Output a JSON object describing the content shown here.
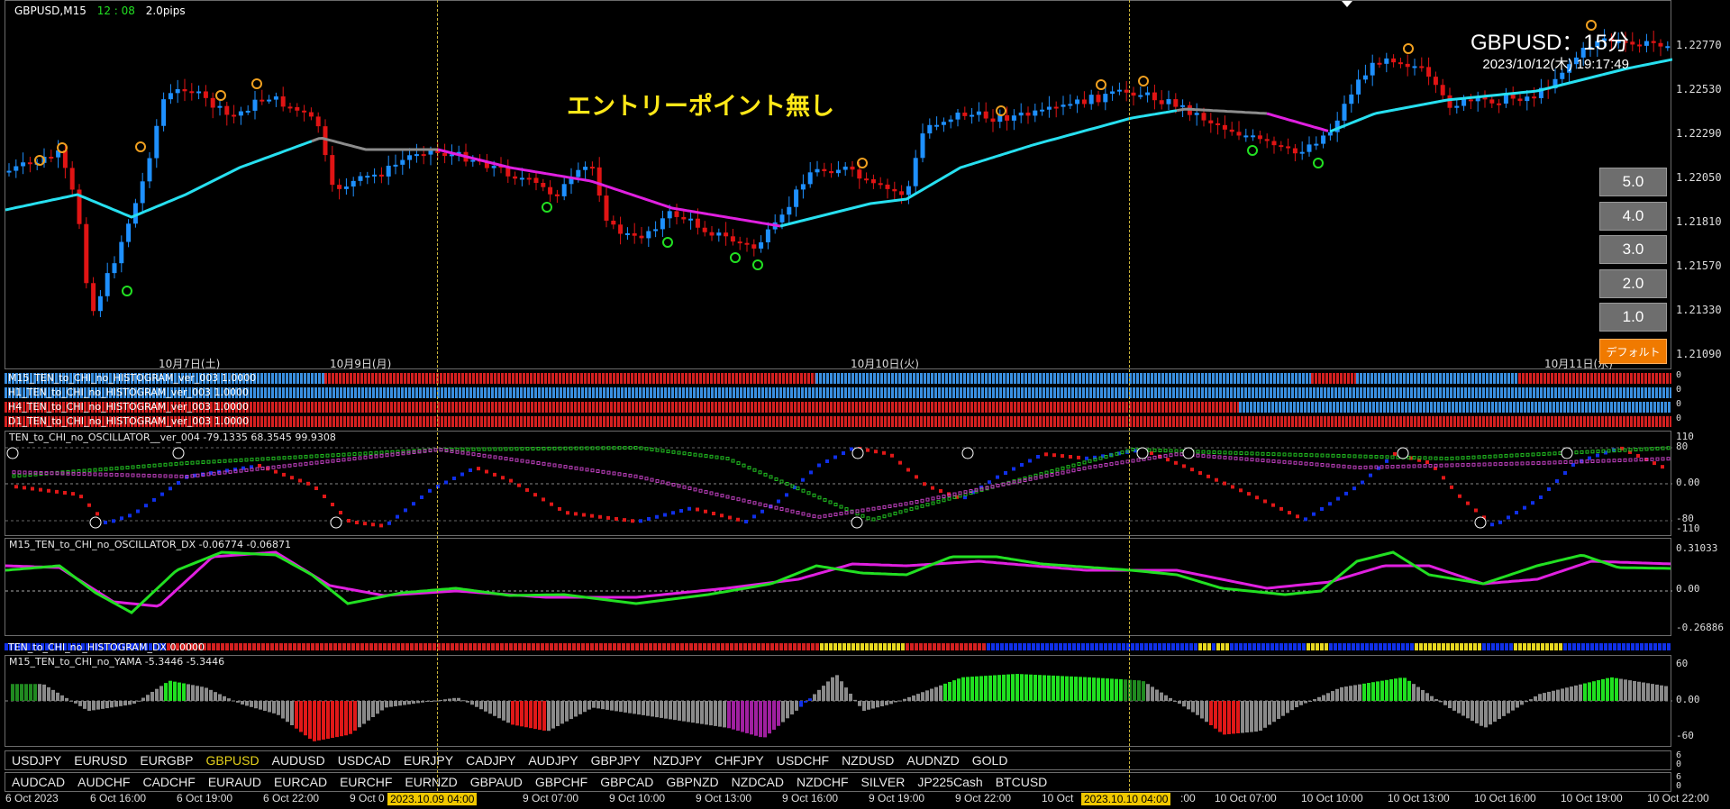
{
  "header": {
    "symbol_tf": "GBPUSD,M15",
    "clock": "12 : 08",
    "spread": "2.0pips"
  },
  "chart_overlay": {
    "pair_title": "GBPUSD：15分",
    "datetime": "2023/10/12(木) 19:17:49",
    "no_entry_text": "エントリーポイント無し"
  },
  "price_axis": [
    "1.22770",
    "1.22530",
    "1.22290",
    "1.22050",
    "1.21810",
    "1.21570",
    "1.21330",
    "1.21090"
  ],
  "day_labels": [
    "10月7日(土)",
    "10月9日(月)",
    "10月10日(火)",
    "10月11日(水)"
  ],
  "tf_buttons": [
    "5.0",
    "4.0",
    "3.0",
    "2.0",
    "1.0"
  ],
  "default_button": "デフォルト",
  "histograms": [
    {
      "title": "M15_TEN_to_CHI_no_HISTOGRAM_ver_003 1.0000",
      "scale": "0"
    },
    {
      "title": "H1_TEN_to_CHI_no_HISTOGRAM_ver_003 1.0000",
      "scale": "0"
    },
    {
      "title": "H4_TEN_to_CHI_no_HISTOGRAM_ver_003 1.0000",
      "scale": "0"
    },
    {
      "title": "D1_TEN_to_CHI_no_HISTOGRAM_ver_003 1.0000",
      "scale": "0"
    }
  ],
  "oscillator": {
    "title": "TEN_to_CHI_no_OSCILLATOR__ver_004 -79.1335 68.3545 99.9308",
    "axis": [
      "110",
      "80",
      "0.00",
      "-80",
      "-110"
    ]
  },
  "oscillator_dx": {
    "title": "M15_TEN_to_CHI_no_OSCILLATOR_DX -0.06774 -0.06871",
    "axis": [
      "0.31033",
      "0.00",
      "-0.26886"
    ]
  },
  "histogram_dx": {
    "title": "TEN_to_CHI_no_HISTOGRAM_DX 0.0000"
  },
  "yama": {
    "title": "M15_TEN_to_CHI_no_YAMA -5.3446 -5.3446",
    "axis": [
      "60",
      "0.00",
      "-60"
    ]
  },
  "symbols_row1": [
    "USDJPY",
    "EURUSD",
    "EURGBP",
    "GBPUSD",
    "AUDUSD",
    "USDCAD",
    "EURJPY",
    "CADJPY",
    "AUDJPY",
    "GBPJPY",
    "NZDJPY",
    "CHFJPY",
    "USDCHF",
    "NZDUSD",
    "AUDNZD",
    "GOLD"
  ],
  "symbols_row1_active": "GBPUSD",
  "symbols_row2": [
    "AUDCAD",
    "AUDCHF",
    "CADCHF",
    "EURAUD",
    "EURCAD",
    "EURCHF",
    "EURNZD",
    "GBPAUD",
    "GBPCHF",
    "GBPCAD",
    "GBPNZD",
    "NZDCAD",
    "NZDCHF",
    "SILVER",
    "JP225Cash",
    "BTCUSD"
  ],
  "sym_axis": [
    "6",
    "0"
  ],
  "time_axis": [
    "6 Oct 2023",
    "6 Oct 16:00",
    "6 Oct 19:00",
    "6 Oct 22:00",
    "9 Oct 0",
    "9 Oct 07:00",
    "9 Oct 10:00",
    "9 Oct 13:00",
    "9 Oct 16:00",
    "9 Oct 19:00",
    "9 Oct 22:00",
    "10 Oct",
    ":00",
    "10 Oct 07:00",
    "10 Oct 10:00",
    "10 Oct 13:00",
    "10 Oct 16:00",
    "10 Oct 19:00",
    "10 Oct 22:00"
  ],
  "time_highlights": [
    "2023.10.09 04:00",
    "2023.10.10 04:00"
  ],
  "colors": {
    "bull": "#1e90ff",
    "bear": "#e01414",
    "ma_cyan": "#27e0f0",
    "ma_magenta": "#e020e0",
    "ma_gray": "#8c8c8c",
    "green": "#22e022",
    "gold": "#f0c800"
  }
}
